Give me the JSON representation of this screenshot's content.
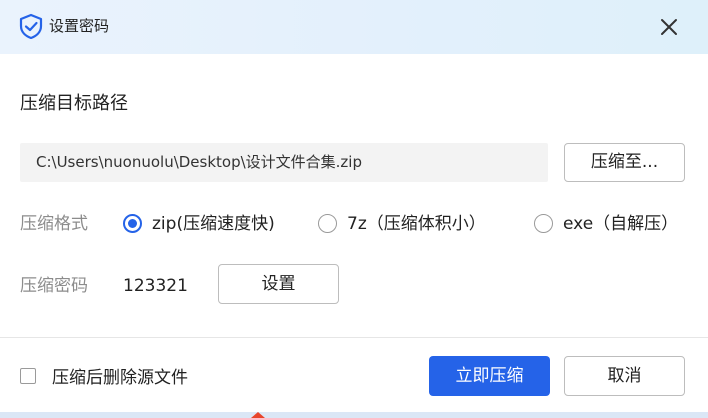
{
  "dialog": {
    "title": "设置密码",
    "accent_color": "#2563e8"
  },
  "target": {
    "section_title": "压缩目标路径",
    "path": "C:\\Users\\nuonuolu\\Desktop\\设计文件合集.zip",
    "browse_label": "压缩至..."
  },
  "format": {
    "label": "压缩格式",
    "options": [
      {
        "label": "zip(压缩速度快)",
        "selected": true
      },
      {
        "label": "7z（压缩体积小）",
        "selected": false
      },
      {
        "label": "exe（自解压）",
        "selected": false
      }
    ]
  },
  "password": {
    "label": "压缩密码",
    "value": "123321",
    "set_label": "设置"
  },
  "footer": {
    "delete_source_label": "压缩后删除源文件",
    "delete_source_checked": false,
    "compress_label": "立即压缩",
    "cancel_label": "取消"
  }
}
